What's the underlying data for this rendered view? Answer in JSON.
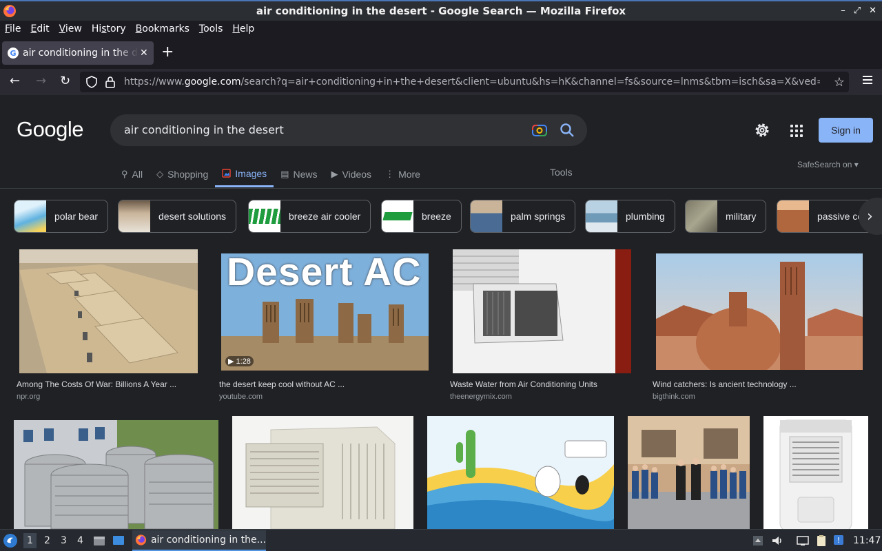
{
  "window": {
    "title": "air conditioning in the desert - Google Search — Mozilla Firefox",
    "controls": [
      "minimize-icon",
      "restore-icon",
      "close-icon"
    ]
  },
  "menubar": {
    "items": [
      {
        "label": "File",
        "key": "F",
        "rest": "ile"
      },
      {
        "label": "Edit",
        "key": "E",
        "rest": "dit"
      },
      {
        "label": "View",
        "key": "V",
        "rest": "iew"
      },
      {
        "label": "History",
        "key": "s",
        "pre": "Hi",
        "rest": "tory"
      },
      {
        "label": "Bookmarks",
        "key": "B",
        "rest": "ookmarks"
      },
      {
        "label": "Tools",
        "key": "T",
        "rest": "ools"
      },
      {
        "label": "Help",
        "key": "H",
        "rest": "elp"
      }
    ]
  },
  "tab": {
    "label": "air conditioning in the desert - Google Search",
    "favicon": "G"
  },
  "nav": {
    "url_prefix": "https://www.",
    "url_domain": "google.com",
    "url_path": "/search?q=air+conditioning+in+the+desert&client=ubuntu&hs=hK&channel=fs&source=lnms&tbm=isch&sa=X&ved="
  },
  "google": {
    "logo": "Google",
    "query": "air conditioning in the desert",
    "signin": "Sign in",
    "tabs": [
      {
        "label": "All",
        "icon": "search-icon"
      },
      {
        "label": "Shopping",
        "icon": "tag-icon"
      },
      {
        "label": "Images",
        "icon": "image-icon",
        "active": true
      },
      {
        "label": "News",
        "icon": "news-icon"
      },
      {
        "label": "Videos",
        "icon": "play-icon"
      },
      {
        "label": "More",
        "icon": "more-vert-icon"
      }
    ],
    "tools": "Tools",
    "safesearch": "SafeSearch on"
  },
  "chips": [
    {
      "label": "polar bear",
      "color": "#8fc7e8"
    },
    {
      "label": "desert solutions",
      "color": "#b9a58c"
    },
    {
      "label": "breeze air cooler",
      "color": "#1f9c3e"
    },
    {
      "label": "breeze",
      "color": "#f2f2f2"
    },
    {
      "label": "palm springs",
      "color": "#5a7fa6"
    },
    {
      "label": "plumbing",
      "color": "#a8c4d8"
    },
    {
      "label": "military",
      "color": "#8c8a76"
    },
    {
      "label": "passive cooling",
      "color": "#b9774c"
    }
  ],
  "results": [
    {
      "title": "Among The Costs Of War: Billions A Year ...",
      "source": "npr.org"
    },
    {
      "title": "the desert keep cool without AC ...",
      "source": "youtube.com",
      "image_text": "Desert AC",
      "duration": "1:28"
    },
    {
      "title": "Waste Water from Air Conditioning Units",
      "source": "theenergymix.com"
    },
    {
      "title": "Wind catchers: Is ancient technology ...",
      "source": "bigthink.com"
    },
    {
      "title": "",
      "source": ""
    },
    {
      "title": "",
      "source": ""
    },
    {
      "title": "",
      "source": ""
    },
    {
      "title": "",
      "source": ""
    },
    {
      "title": "",
      "source": ""
    }
  ],
  "taskbar": {
    "workspaces": [
      "1",
      "2",
      "3",
      "4"
    ],
    "active_task": "air conditioning in the...",
    "clock": "11:47"
  },
  "colors": {
    "accent": "#8ab4f8",
    "page_bg": "#202124",
    "signin_bg": "#8ab4f8"
  }
}
